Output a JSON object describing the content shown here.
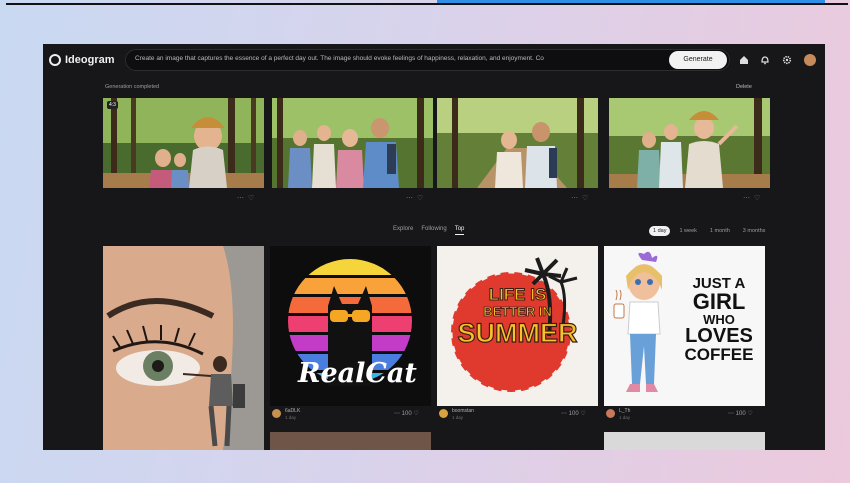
{
  "app": {
    "brand": "Ideogram"
  },
  "prompt": {
    "text": "Create an image that captures the essence of a perfect day out. The image should evoke feelings of happiness, relaxation, and enjoyment. Co",
    "generate_label": "Generate"
  },
  "header_icons": [
    "home-icon",
    "bell-icon",
    "gear-icon",
    "user-avatar"
  ],
  "generation": {
    "status": "Generation completed",
    "action": "Delete",
    "images": [
      {
        "name": "generated-image-1",
        "badge": "4:3"
      },
      {
        "name": "generated-image-2"
      },
      {
        "name": "generated-image-3"
      },
      {
        "name": "generated-image-4"
      }
    ]
  },
  "feed": {
    "tabs": [
      "Explore",
      "Following",
      "Top"
    ],
    "active_tab": "Top",
    "periods": [
      "1 day",
      "1 week",
      "1 month",
      "3 months"
    ],
    "active_period": "1 day",
    "cards": [
      {
        "title": "RealCat",
        "user": "6aDLK",
        "sub": "1 day",
        "likes": "100"
      },
      {
        "title_lines": [
          "LIFE IS",
          "BETTER IN",
          "SUMMER"
        ],
        "user": "boomstan",
        "sub": "1 day",
        "likes": "100"
      },
      {
        "title_lines": [
          "JUST A",
          "GIRL",
          "WHO",
          "LOVES",
          "COFFEE"
        ],
        "user": "L_Th",
        "sub": "1 day",
        "likes": "100"
      }
    ]
  },
  "colors": {
    "app_bg": "#17171a",
    "accent_bar": "#2f8fe6",
    "summer_red": "#e03a2f",
    "summer_yellow": "#f5c22d"
  }
}
